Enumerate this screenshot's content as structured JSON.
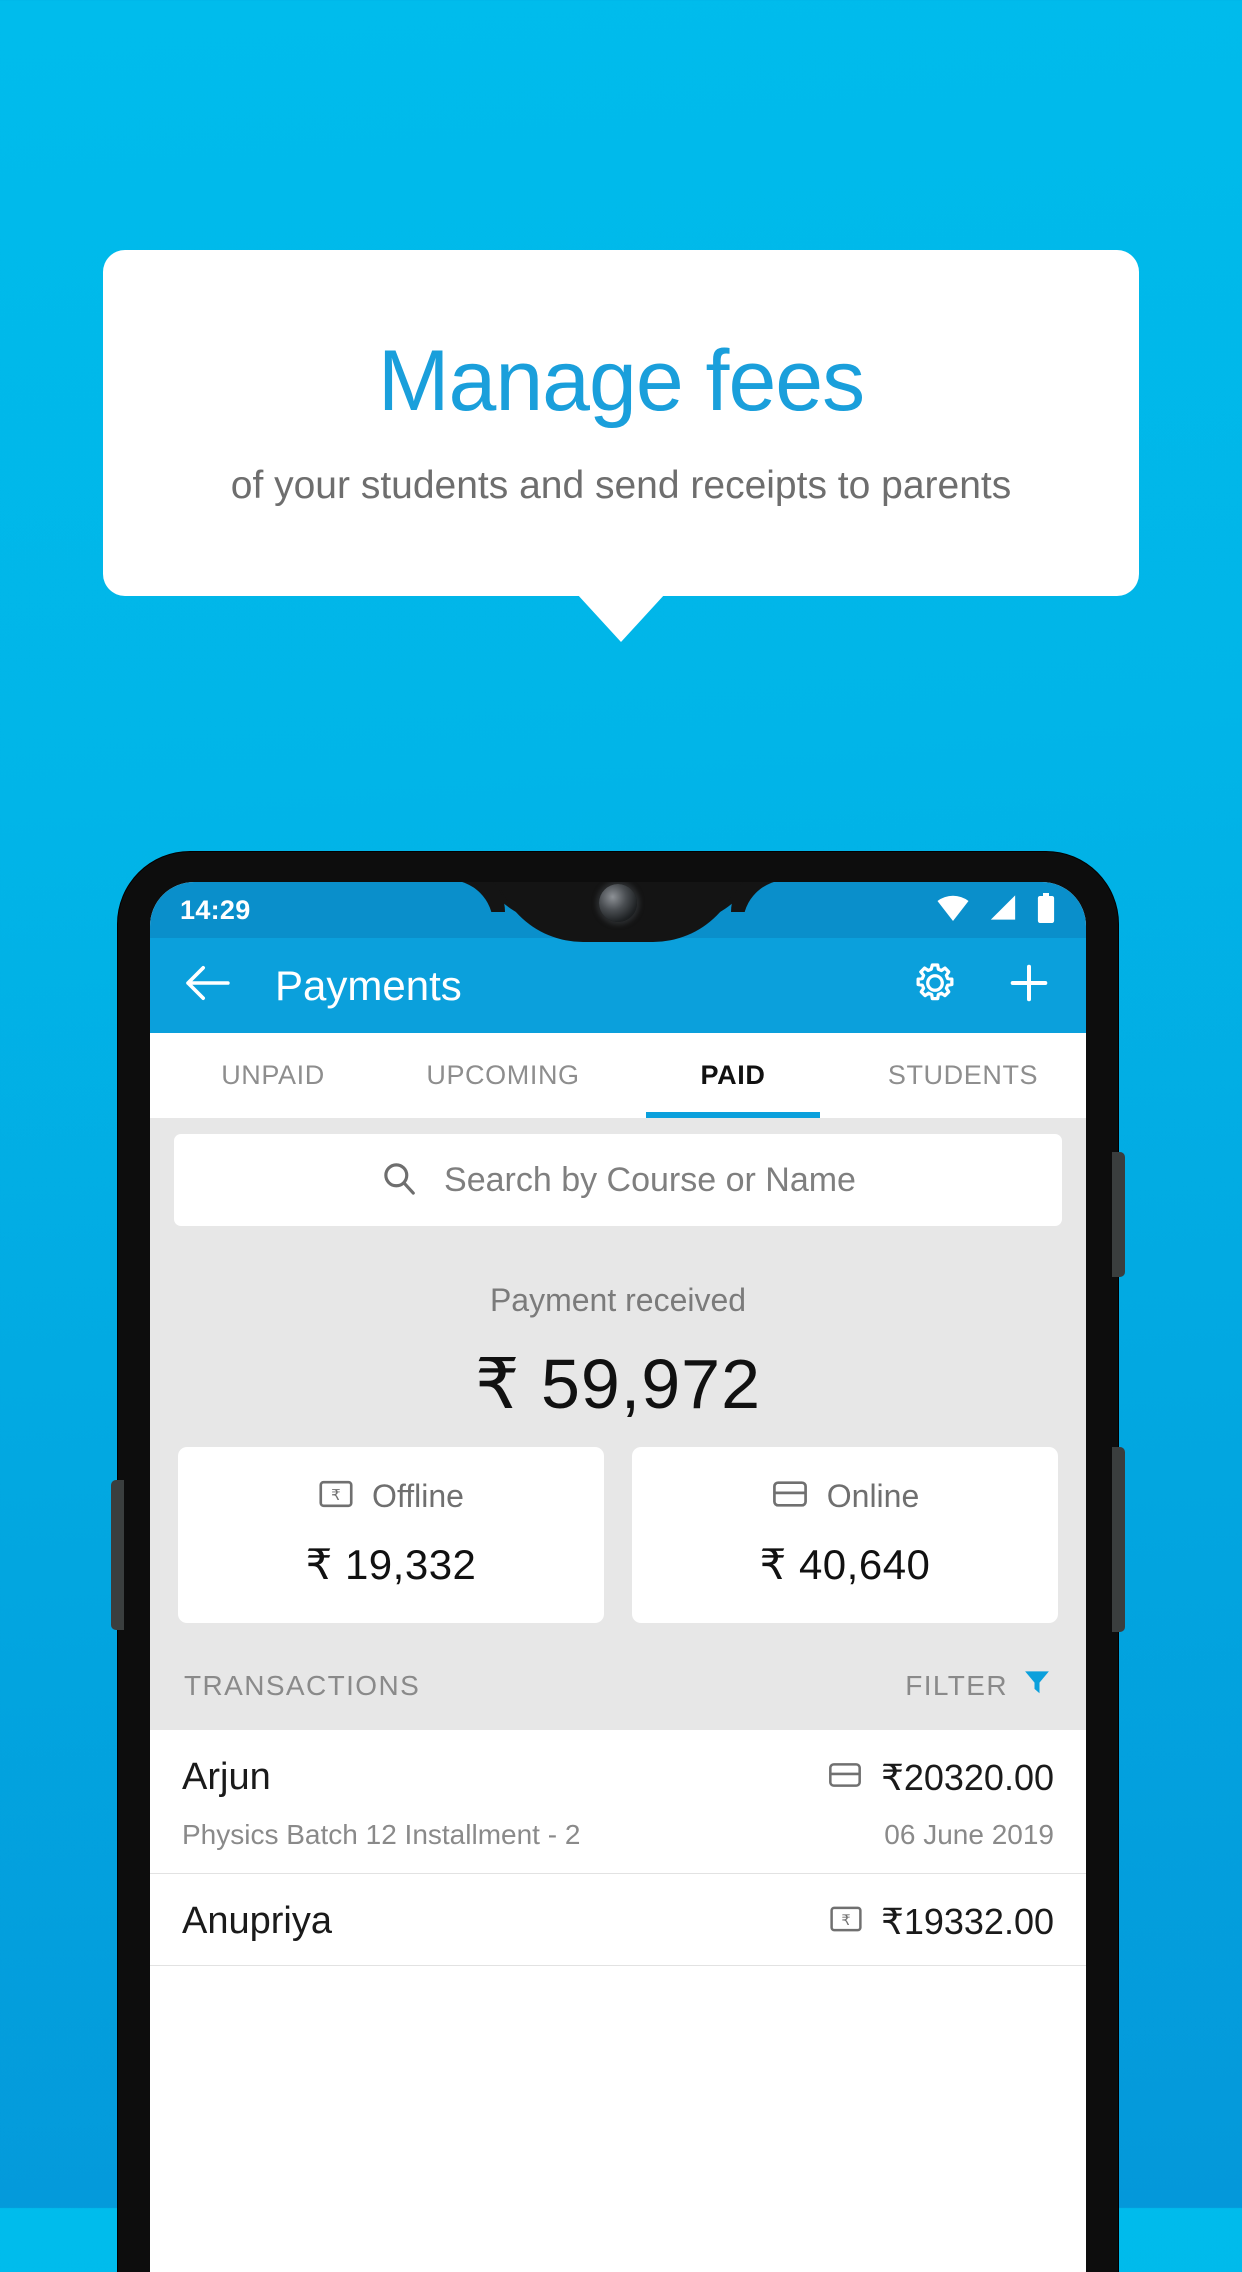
{
  "promo": {
    "title": "Manage fees",
    "subtitle": "of your students and send receipts to parents",
    "accent_color": "#1A9FDB",
    "background_top": "#00BCEC",
    "background_bottom": "#0498DA"
  },
  "phone": {
    "status_bar": {
      "clock": "14:29",
      "icons": [
        "wifi-icon",
        "signal-icon",
        "battery-icon"
      ],
      "background": "#0A8FCB"
    },
    "app_bar": {
      "back_icon": "back-arrow-icon",
      "title": "Payments",
      "settings_icon": "gear-icon",
      "add_icon": "plus-icon",
      "background": "#0BA0DC"
    },
    "tabs": [
      {
        "label": "UNPAID",
        "active": false
      },
      {
        "label": "UPCOMING",
        "active": false
      },
      {
        "label": "PAID",
        "active": true
      },
      {
        "label": "STUDENTS",
        "active": false
      }
    ],
    "search": {
      "icon": "search-icon",
      "placeholder": "Search by Course or Name"
    },
    "summary": {
      "label": "Payment received",
      "amount": "₹ 59,972"
    },
    "payment_cards": [
      {
        "icon": "rupee-note-icon",
        "label": "Offline",
        "amount": "₹ 19,332"
      },
      {
        "icon": "credit-card-icon",
        "label": "Online",
        "amount": "₹ 40,640"
      }
    ],
    "transactions_header": {
      "title": "TRANSACTIONS",
      "filter_label": "FILTER",
      "filter_icon": "funnel-icon",
      "filter_icon_color": "#0BA0DC"
    },
    "transactions": [
      {
        "name": "Arjun",
        "description": "Physics Batch 12 Installment - 2",
        "amount": "₹20320.00",
        "date": "06 June 2019",
        "method_icon": "credit-card-icon"
      },
      {
        "name": "Anupriya",
        "description": "",
        "amount": "₹19332.00",
        "date": "",
        "method_icon": "rupee-note-icon"
      }
    ]
  }
}
